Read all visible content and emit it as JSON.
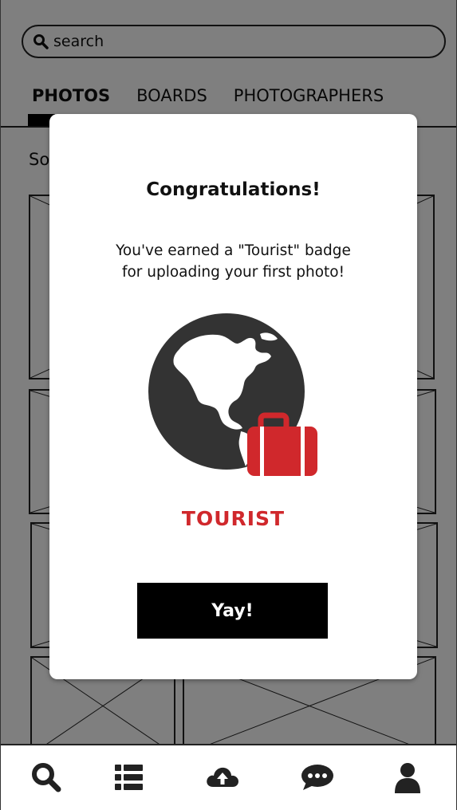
{
  "search": {
    "placeholder": "search",
    "icon": "search-icon"
  },
  "tabs": [
    {
      "label": "PHOTOS",
      "active": true
    },
    {
      "label": "BOARDS",
      "active": false
    },
    {
      "label": "PHOTOGRAPHERS",
      "active": false
    }
  ],
  "content": {
    "sort_label_partial": "So"
  },
  "modal": {
    "title": "Congratulations!",
    "message_line1": "You've earned a \"Tourist\" badge",
    "message_line2": "for uploading your first photo!",
    "badge_name": "TOURIST",
    "badge_icons": [
      "globe-icon",
      "suitcase-icon"
    ],
    "button_label": "Yay!"
  },
  "bottom_nav": [
    {
      "name": "search",
      "icon": "search-icon"
    },
    {
      "name": "list",
      "icon": "list-icon"
    },
    {
      "name": "upload",
      "icon": "cloud-upload-icon"
    },
    {
      "name": "messages",
      "icon": "chat-icon"
    },
    {
      "name": "profile",
      "icon": "user-icon"
    }
  ],
  "colors": {
    "accent": "#d0282c",
    "globe": "#333333",
    "button": "#000000",
    "overlay": "rgba(0,0,0,0.5)"
  }
}
